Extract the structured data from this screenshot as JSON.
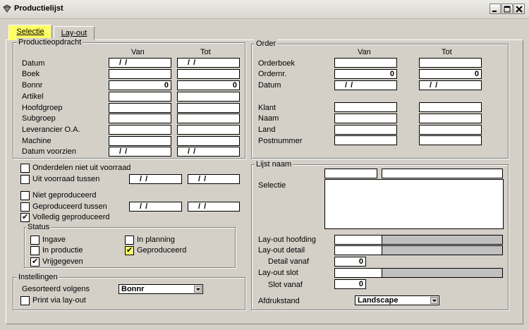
{
  "window": {
    "title": "Productielijst"
  },
  "tabs": [
    "Selectie",
    "Lay-out"
  ],
  "productieopdracht": {
    "legend": "Productieopdracht",
    "col_van": "Van",
    "col_tot": "Tot",
    "rows": [
      {
        "label": "Datum",
        "van": "/  /",
        "tot": "/  /"
      },
      {
        "label": "Boek",
        "van": "",
        "tot": ""
      },
      {
        "label": "Bonnr",
        "van": "0",
        "tot": "0"
      },
      {
        "label": "Artikel",
        "van": "",
        "tot": ""
      },
      {
        "label": "Hoofdgroep",
        "van": "",
        "tot": ""
      },
      {
        "label": "Subgroep",
        "van": "",
        "tot": ""
      },
      {
        "label": "Leverancier O.A.",
        "van": "",
        "tot": ""
      },
      {
        "label": "Machine",
        "van": "",
        "tot": ""
      },
      {
        "label": "Datum voorzien",
        "van": "/  /",
        "tot": "/  /"
      }
    ]
  },
  "options": {
    "onderdelen": "Onderdelen niet uit voorraad",
    "uit_voorraad": "Uit voorraad tussen",
    "uit_voorraad_van": "/  /",
    "uit_voorraad_tot": "/  /",
    "niet_geproduceerd": "Niet geproduceerd",
    "geproduceerd_tussen": "Geproduceerd tussen",
    "geproduceerd_van": "/  /",
    "geproduceerd_tot": "/  /",
    "volledig": "Volledig geproduceerd"
  },
  "status": {
    "legend": "Status",
    "ingave": "Ingave",
    "in_productie": "In productie",
    "vrijgegeven": "Vrijgegeven",
    "in_planning": "In planning",
    "geproduceerd": "Geproduceerd"
  },
  "instellingen": {
    "legend": "Instellingen",
    "gesorteerd": "Gesorteerd volgens",
    "gesorteerd_value": "Bonnr",
    "print": "Print via lay-out"
  },
  "order": {
    "legend": "Order",
    "col_van": "Van",
    "col_tot": "Tot",
    "rows": [
      {
        "label": "Orderboek",
        "van": "",
        "tot": ""
      },
      {
        "label": "Ordernr.",
        "van": "0",
        "tot": "0"
      },
      {
        "label": "Datum",
        "van": "/  /",
        "tot": "/  /"
      }
    ],
    "rows2": [
      {
        "label": "Klant"
      },
      {
        "label": "Naam"
      },
      {
        "label": "Land"
      },
      {
        "label": "Postnummer"
      }
    ]
  },
  "lijst": {
    "legend": "Lijst naam",
    "selectie": "Selectie",
    "layout_hoofding": "Lay-out hoofding",
    "layout_detail": "Lay-out detail",
    "detail_vanaf": "Detail vanaf",
    "detail_vanaf_value": "0",
    "layout_slot": "Lay-out slot",
    "slot_vanaf": "Slot vanaf",
    "slot_vanaf_value": "0",
    "afdrukstand": "Afdrukstand",
    "afdrukstand_value": "Landscape"
  }
}
